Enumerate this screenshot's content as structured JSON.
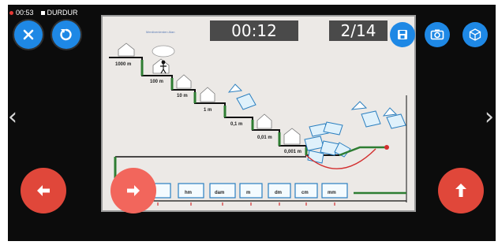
{
  "status": {
    "time": "00:53",
    "state": "DURDUR"
  },
  "hud": {
    "timer": "00:12",
    "progress": "2/14"
  },
  "board": {
    "caption": "Merdivenlerden Alan",
    "step_labels": [
      "1000 m",
      "100 m",
      "10 m",
      "1 m",
      "0,1 m",
      "0,01 m",
      "0,001 m"
    ],
    "slots": [
      "",
      "hm",
      "dam",
      "m",
      "dm",
      "cm",
      "mm"
    ]
  },
  "icons": {
    "close": "close-icon",
    "undo": "undo-icon",
    "save": "save-icon",
    "camera": "camera-icon",
    "view3d": "cube-3d-icon",
    "left": "arrow-left-icon",
    "right": "arrow-right-icon",
    "up": "arrow-up-icon"
  },
  "colors": {
    "accent": "#1e88e5",
    "action": "#e0473a",
    "stairs": "#2e7d32"
  }
}
